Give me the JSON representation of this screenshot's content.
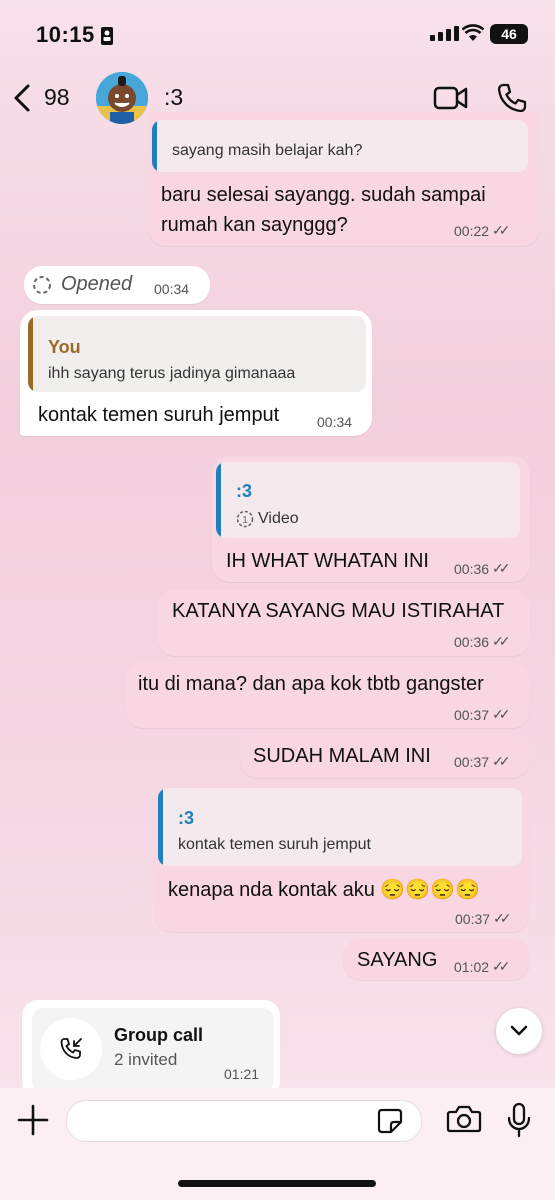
{
  "status_bar": {
    "time": "10:15",
    "battery": "46"
  },
  "header": {
    "back_count": "98",
    "contact_name": ":3"
  },
  "messages": {
    "m1": {
      "quote_text": "sayang masih belajar kah?",
      "line1": "baru selesai sayangg. sudah sampai",
      "line2": "rumah kan saynggg?",
      "time": "00:22"
    },
    "m2": {
      "text": "Opened",
      "time": "00:34"
    },
    "m3": {
      "quote_name": "You",
      "quote_text": "ihh sayang terus jadinya gimanaaa",
      "text": "kontak temen suruh jemput",
      "time": "00:34"
    },
    "m4": {
      "quote_name": ":3",
      "quote_text": "Video",
      "text": "IH WHAT WHATAN INI",
      "time": "00:36"
    },
    "m5": {
      "text": "KATANYA SAYANG MAU ISTIRAHAT",
      "time": "00:36"
    },
    "m6": {
      "text": "itu di mana? dan apa kok tbtb gangster",
      "time": "00:37"
    },
    "m7": {
      "text": "SUDAH MALAM INI",
      "time": "00:37"
    },
    "m8": {
      "quote_name": ":3",
      "quote_text": "kontak temen suruh jemput",
      "text": "kenapa nda kontak aku 😔😔😔😔",
      "time": "00:37"
    },
    "m9": {
      "text": "SAYANG",
      "time": "01:02"
    },
    "call": {
      "title": "Group call",
      "subtitle": "2 invited",
      "time": "01:21"
    }
  },
  "colors": {
    "accent_blue": "#1f7fbf",
    "accent_brown": "#9a6a2a",
    "bubble_out": "#f8d7e2",
    "bubble_in": "#ffffff"
  },
  "icons": [
    "back-icon",
    "video-call-icon",
    "phone-icon",
    "opened-icon",
    "view-once-icon",
    "scroll-down-icon",
    "incoming-call-icon",
    "plus-icon",
    "sticker-icon",
    "camera-icon",
    "mic-icon"
  ]
}
